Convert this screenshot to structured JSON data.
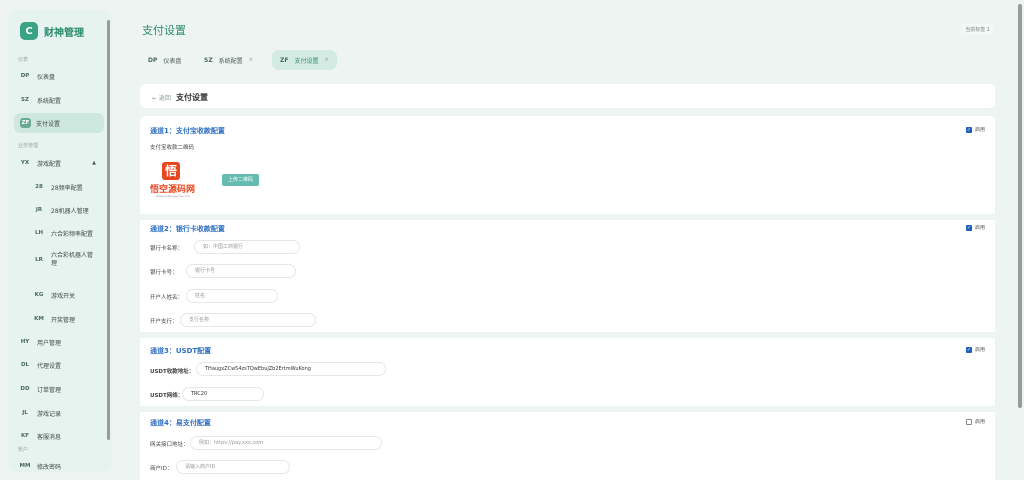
{
  "brand": {
    "logo_letter": "C",
    "name": "财神管理"
  },
  "sidebar": {
    "section_home": "仪表",
    "section_business": "业务管理",
    "section_account": "账户",
    "items": [
      {
        "code": "DP",
        "label": "仪表盘"
      },
      {
        "code": "SZ",
        "label": "系统配置"
      },
      {
        "code": "ZF",
        "label": "支付设置"
      },
      {
        "code": "YX",
        "label": "游戏配置",
        "caret": "▲"
      },
      {
        "code": "28",
        "label": "28频率配置"
      },
      {
        "code": "JR",
        "label": "28机器人管理"
      },
      {
        "code": "LH",
        "label": "六合彩频率配置"
      },
      {
        "code": "LR",
        "label": "六合彩机器人管理"
      },
      {
        "code": "KG",
        "label": "游戏开关"
      },
      {
        "code": "KM",
        "label": "开奖管理"
      },
      {
        "code": "HY",
        "label": "用户管理"
      },
      {
        "code": "DL",
        "label": "代理设置"
      },
      {
        "code": "DD",
        "label": "订单管理"
      },
      {
        "code": "JL",
        "label": "游戏记录"
      },
      {
        "code": "KF",
        "label": "客服消息"
      },
      {
        "code": "MM",
        "label": "修改密码"
      }
    ]
  },
  "header": {
    "title": "支付设置",
    "chip": "当前标签 1"
  },
  "tabs": [
    {
      "code": "DP",
      "label": "仪表盘",
      "close": ""
    },
    {
      "code": "SZ",
      "label": "系统配置",
      "close": "×"
    },
    {
      "code": "ZF",
      "label": "支付设置",
      "close": "×"
    }
  ],
  "breadcrumb": {
    "back": "← 返回",
    "title": "支付设置"
  },
  "channel1": {
    "title": "通道1：支付宝收款配置",
    "enable_label": "启用",
    "qr_label": "支付宝收款二维码",
    "logo_char": "悟",
    "logo_text": "悟空源码网",
    "logo_sub": "www.wukongymw.com",
    "upload_label": "上传二维码"
  },
  "channel2": {
    "title": "通道2：银行卡收款配置",
    "enable_label": "启用",
    "fields": [
      {
        "label": "银行卡名称：",
        "placeholder": "如：中国工商银行"
      },
      {
        "label": "银行卡号：",
        "placeholder": "银行卡号"
      },
      {
        "label": "开户人姓名：",
        "placeholder": "姓名"
      },
      {
        "label": "开户支行：",
        "placeholder": "支行名称"
      }
    ]
  },
  "channel3": {
    "title": "通道3：USDT配置",
    "enable_label": "启用",
    "address_label": "USDT收款地址：",
    "address_value": "THaugxZCw54zsTQwEbujZb2ErtmWuKong",
    "network_label": "USDT网络：",
    "network_value": "TRC20"
  },
  "channel4": {
    "title": "通道4：易支付配置",
    "enable_label": "启用",
    "gateway_label": "网关接口地址：",
    "gateway_placeholder": "例如：https://pay.xxx.com",
    "merchant_label": "商户ID：",
    "merchant_placeholder": "请输入商户ID"
  }
}
